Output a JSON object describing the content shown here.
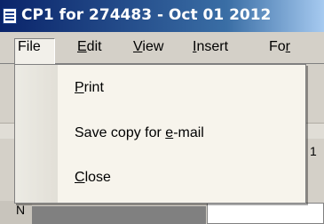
{
  "window": {
    "title": "CP1 for 274483 - Oct 01 2012"
  },
  "menubar": {
    "items": [
      {
        "pre": "",
        "acc": "F",
        "post": "ile"
      },
      {
        "pre": "",
        "acc": "E",
        "post": "dit"
      },
      {
        "pre": "",
        "acc": "V",
        "post": "iew"
      },
      {
        "pre": "",
        "acc": "I",
        "post": "nsert"
      },
      {
        "pre": "Fo",
        "acc": "r",
        "post": ""
      }
    ]
  },
  "file_menu": {
    "items": [
      {
        "pre": "",
        "acc": "P",
        "post": "rint"
      },
      {
        "pre": "Save copy for ",
        "acc": "e",
        "post": "-mail"
      },
      {
        "pre": "",
        "acc": "C",
        "post": "lose"
      }
    ]
  },
  "background": {
    "ruler_number": "1",
    "corner_glyph": "N"
  },
  "colors": {
    "titlebar_start": "#0a246a",
    "titlebar_end": "#a6caf0",
    "menu_bg": "#d4d0c8",
    "dropdown_bg": "#f7f4ec"
  },
  "icons": {
    "app_icon": "document-icon"
  }
}
